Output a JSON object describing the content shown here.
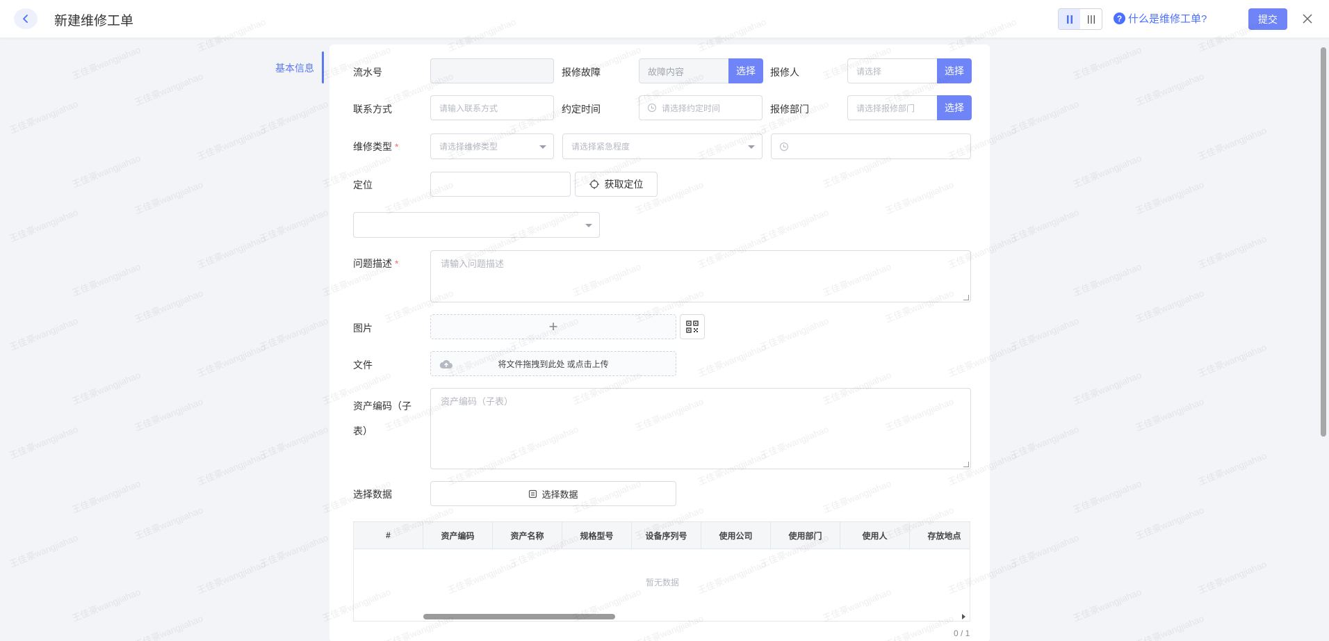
{
  "header": {
    "title": "新建维修工单",
    "help_text": "什么是维修工单?",
    "submit_label": "提交"
  },
  "anchor": {
    "items": [
      {
        "label": "基本信息"
      }
    ]
  },
  "form": {
    "serial": {
      "label": "流水号",
      "value": ""
    },
    "fault": {
      "label": "报修故障",
      "value": "故障内容",
      "button": "选择"
    },
    "reporter": {
      "label": "报修人",
      "placeholder": "请选择",
      "button": "选择"
    },
    "contact": {
      "label": "联系方式",
      "placeholder": "请输入联系方式"
    },
    "appointment": {
      "label": "约定时间",
      "placeholder": "请选择约定时间"
    },
    "department": {
      "label": "报修部门",
      "placeholder": "请选择报修部门",
      "button": "选择"
    },
    "repair_type": {
      "label": "维修类型",
      "required_mark": "*",
      "placeholder": "请选择维修类型"
    },
    "urgency": {
      "placeholder": "请选择紧急程度"
    },
    "time_extra": {
      "value": ""
    },
    "location": {
      "label": "定位",
      "value": "",
      "button": "获取定位"
    },
    "location_select": {
      "value": ""
    },
    "description": {
      "label": "问题描述",
      "required_mark": "*",
      "placeholder": "请输入问题描述"
    },
    "image": {
      "label": "图片",
      "add_symbol": "+"
    },
    "file": {
      "label": "文件",
      "hint": "将文件拖拽到此处 或点击上传"
    },
    "asset_code": {
      "label": "资产编码（子表）",
      "placeholder": "资产编码（子表）"
    },
    "select_data": {
      "label": "选择数据",
      "button": "选择数据"
    }
  },
  "table": {
    "columns": [
      "#",
      "资产编码",
      "资产名称",
      "规格型号",
      "设备序列号",
      "使用公司",
      "使用部门",
      "使用人",
      "存放地点"
    ],
    "empty_text": "暂无数据",
    "pager": "0 / 1"
  },
  "watermark": {
    "text": "王佳豪wangjiahao"
  },
  "colors": {
    "accent": "#6f85f7",
    "link": "#4b6fff",
    "required": "#f56c6c"
  }
}
